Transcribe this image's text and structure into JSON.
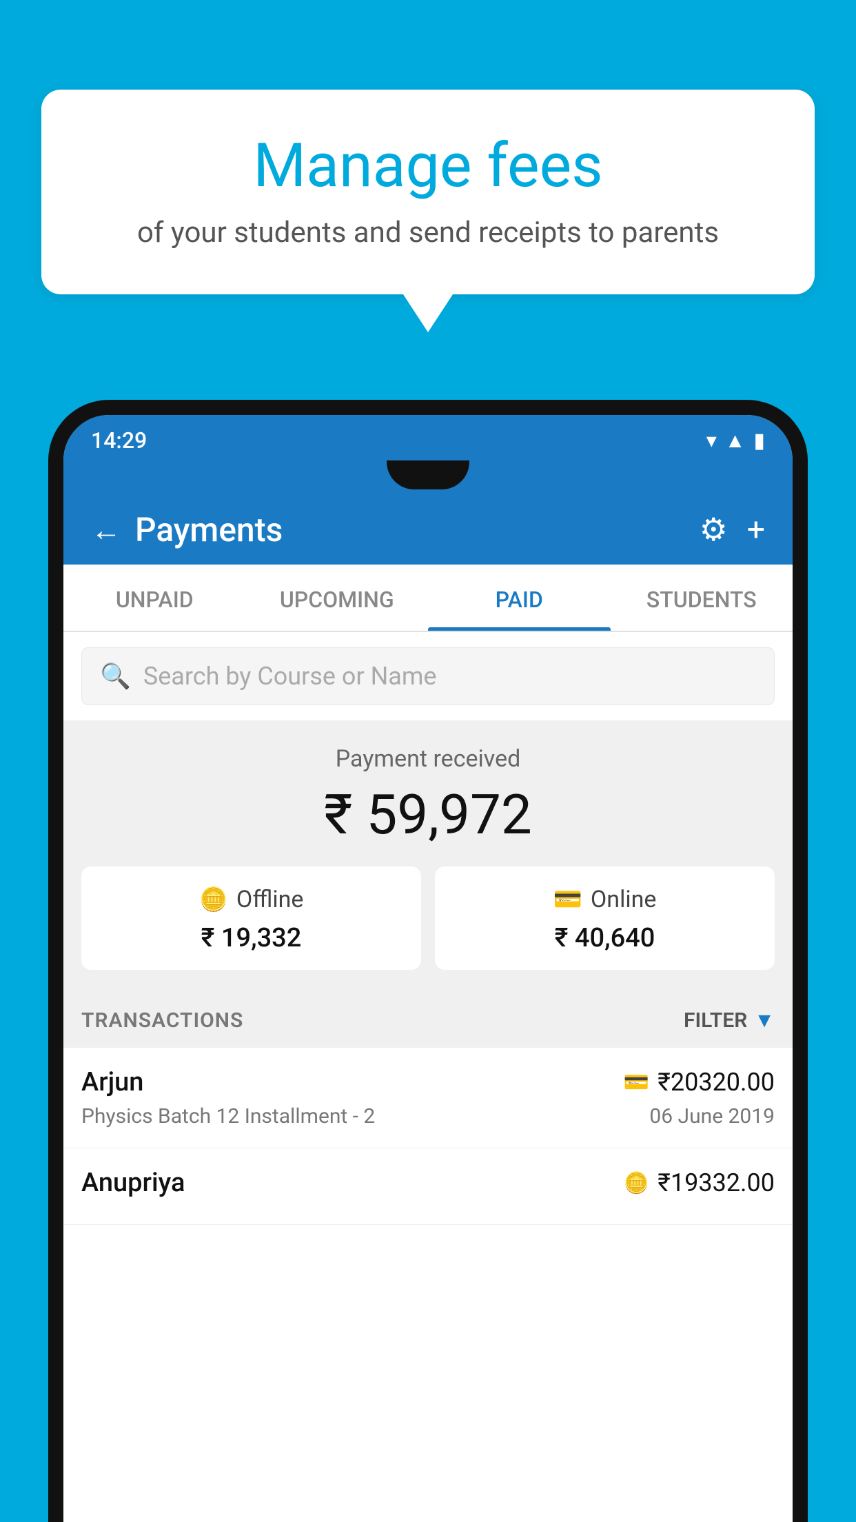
{
  "bubble": {
    "title": "Manage fees",
    "subtitle": "of your students and send receipts to parents"
  },
  "statusBar": {
    "time": "14:29",
    "icons": [
      "wifi",
      "signal",
      "battery"
    ]
  },
  "appBar": {
    "title": "Payments",
    "backLabel": "←",
    "settingsLabel": "⚙",
    "addLabel": "+"
  },
  "tabs": [
    {
      "label": "UNPAID",
      "active": false
    },
    {
      "label": "UPCOMING",
      "active": false
    },
    {
      "label": "PAID",
      "active": true
    },
    {
      "label": "STUDENTS",
      "active": false
    }
  ],
  "search": {
    "placeholder": "Search by Course or Name"
  },
  "paymentSummary": {
    "receivedLabel": "Payment received",
    "totalAmount": "₹ 59,972",
    "offline": {
      "label": "Offline",
      "amount": "₹ 19,332"
    },
    "online": {
      "label": "Online",
      "amount": "₹ 40,640"
    }
  },
  "transactionsSection": {
    "label": "TRANSACTIONS",
    "filterLabel": "FILTER"
  },
  "transactions": [
    {
      "name": "Arjun",
      "course": "Physics Batch 12 Installment - 2",
      "amount": "₹20320.00",
      "date": "06 June 2019",
      "type": "online"
    },
    {
      "name": "Anupriya",
      "course": "",
      "amount": "₹19332.00",
      "date": "",
      "type": "offline"
    }
  ],
  "colors": {
    "primary": "#1a7bc4",
    "background": "#00AADD",
    "white": "#ffffff"
  }
}
